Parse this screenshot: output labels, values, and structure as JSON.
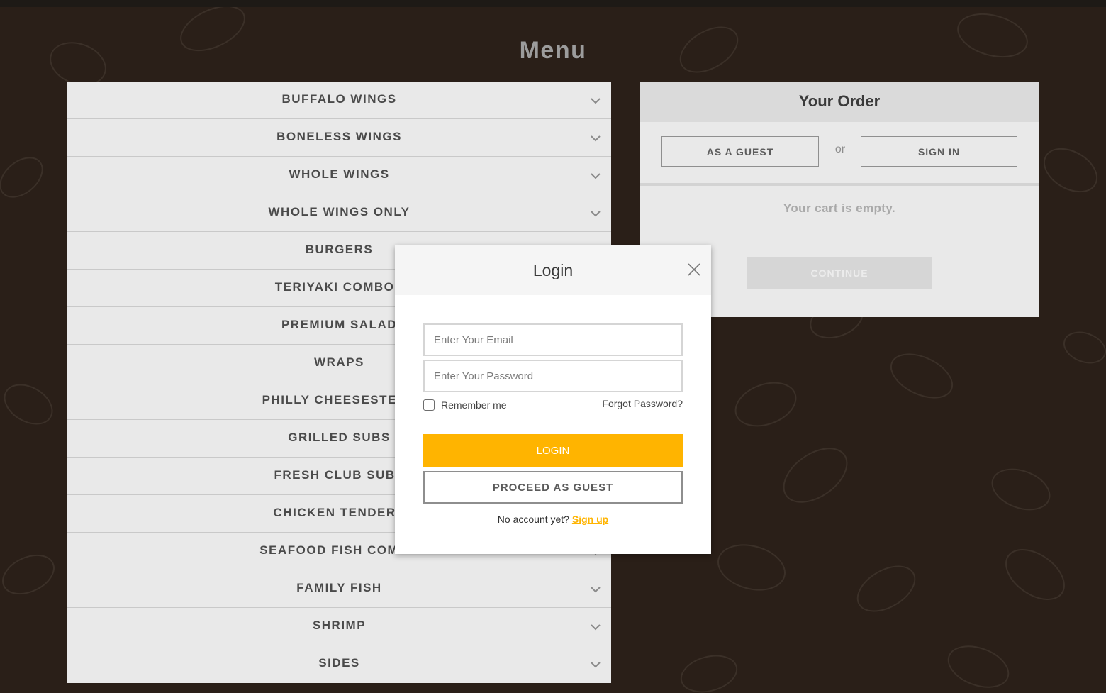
{
  "page": {
    "title": "Menu"
  },
  "menu": {
    "items": [
      {
        "label": "BUFFALO WINGS",
        "expandable": true
      },
      {
        "label": "BONELESS WINGS",
        "expandable": true
      },
      {
        "label": "WHOLE WINGS",
        "expandable": true
      },
      {
        "label": "WHOLE WINGS ONLY",
        "expandable": true
      },
      {
        "label": "BURGERS",
        "expandable": true
      },
      {
        "label": "TERIYAKI COMBOS",
        "expandable": true
      },
      {
        "label": "PREMIUM SALAD",
        "expandable": true
      },
      {
        "label": "WRAPS",
        "expandable": true
      },
      {
        "label": "PHILLY CHEESESTEAK",
        "expandable": true
      },
      {
        "label": "GRILLED SUBS",
        "expandable": true
      },
      {
        "label": "FRESH CLUB SUBS",
        "expandable": true
      },
      {
        "label": "CHICKEN TENDERS",
        "expandable": true
      },
      {
        "label": "SEAFOOD FISH COMBO",
        "expandable": true
      },
      {
        "label": "FAMILY FISH",
        "expandable": true
      },
      {
        "label": "SHRIMP",
        "expandable": true
      },
      {
        "label": "SIDES",
        "expandable": true
      }
    ]
  },
  "order": {
    "title": "Your Order",
    "guest_label": "AS A GUEST",
    "or_label": "or",
    "signin_label": "SIGN IN",
    "empty_text": "Your cart is empty.",
    "continue_label": "CONTINUE"
  },
  "login_modal": {
    "title": "Login",
    "email_placeholder": "Enter Your Email",
    "email_value": "",
    "password_placeholder": "Enter Your Password",
    "password_value": "",
    "remember_label": "Remember me",
    "remember_checked": false,
    "forgot_label": "Forgot Password?",
    "login_label": "LOGIN",
    "proceed_label": "PROCEED AS GUEST",
    "no_account_text": "No account yet?",
    "signup_label": "Sign up"
  },
  "icons": {
    "close": "close-icon",
    "chevron": "chevron-down-icon",
    "background": "chicken-doodle-pattern"
  },
  "colors": {
    "background": "#2a1f18",
    "accent": "#ffb400",
    "panel": "#e9e9e9",
    "title": "#9c9c9c"
  }
}
